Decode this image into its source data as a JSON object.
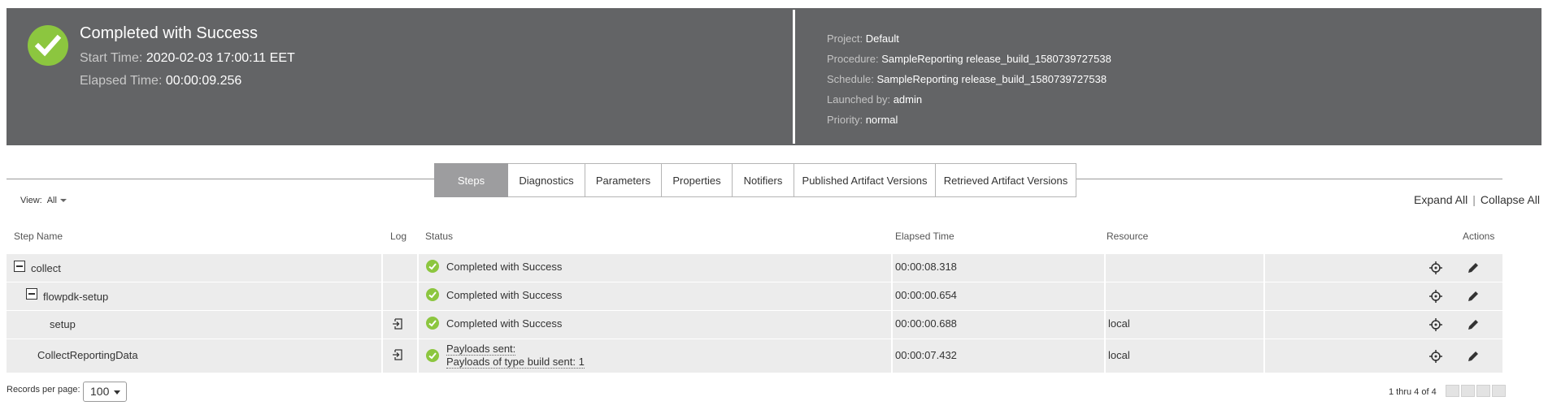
{
  "header": {
    "status_title": "Completed with Success",
    "start_time_label": "Start Time:",
    "start_time": "2020-02-03 17:00:11 EET",
    "elapsed_label": "Elapsed Time:",
    "elapsed": "00:00:09.256",
    "meta": [
      {
        "label": "Project:",
        "value": "Default"
      },
      {
        "label": "Procedure:",
        "value": "SampleReporting release_build_1580739727538"
      },
      {
        "label": "Schedule:",
        "value": "SampleReporting release_build_1580739727538"
      },
      {
        "label": "Launched by:",
        "value": "admin"
      },
      {
        "label": "Priority:",
        "value": "normal"
      }
    ]
  },
  "tabs": [
    {
      "label": "Steps",
      "active": true
    },
    {
      "label": "Diagnostics"
    },
    {
      "label": "Parameters"
    },
    {
      "label": "Properties"
    },
    {
      "label": "Notifiers"
    },
    {
      "label": "Published Artifact Versions"
    },
    {
      "label": "Retrieved Artifact Versions"
    }
  ],
  "view": {
    "label": "View:",
    "value": "All"
  },
  "expand": {
    "expand_all": "Expand All",
    "separator": "|",
    "collapse_all": "Collapse All"
  },
  "columns": {
    "step_name": "Step Name",
    "log": "Log",
    "status": "Status",
    "elapsed": "Elapsed Time",
    "resource": "Resource",
    "actions": "Actions"
  },
  "rows": [
    {
      "name": "collect",
      "status": "Completed with Success",
      "elapsed": "00:00:08.318",
      "resource": ""
    },
    {
      "name": "flowpdk-setup",
      "status": "Completed with Success",
      "elapsed": "00:00:00.654",
      "resource": ""
    },
    {
      "name": "setup",
      "status": "Completed with Success",
      "elapsed": "00:00:00.688",
      "resource": "local"
    },
    {
      "name": "CollectReportingData",
      "status_line1": "Payloads sent:",
      "status_line2": "Payloads of type build sent: 1",
      "elapsed": "00:00:07.432",
      "resource": "local"
    }
  ],
  "footer": {
    "records_per_page_label": "Records per page:",
    "records_per_page": "100",
    "range": "1 thru 4 of 4"
  },
  "colors": {
    "header_bg": "#636466",
    "success": "#8cc63f",
    "active_tab": "#9d9d9f",
    "row_bg": "#ececec"
  }
}
